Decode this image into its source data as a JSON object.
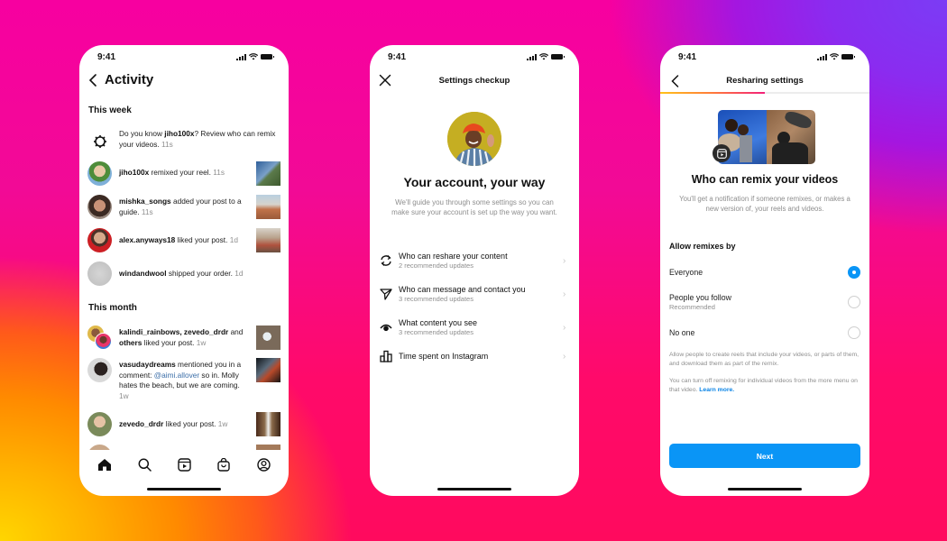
{
  "colors": {
    "accent_blue": "#0a95f6",
    "link_blue": "#0a84e6",
    "mention_blue": "#3b6ea8",
    "muted_text": "#8e8e8e",
    "primary_text": "#111111"
  },
  "status_bar": {
    "time": "9:41"
  },
  "activity_screen": {
    "title": "Activity",
    "back_icon": "chevron-left-icon",
    "sections": [
      {
        "heading": "This week",
        "items": [
          {
            "type": "prompt",
            "icon": "settings-gear-icon",
            "prefix": "Do you know ",
            "user": "jiho100x",
            "text": "? Review who can remix your videos.",
            "time": "11s"
          },
          {
            "type": "activity",
            "user": "jiho100x",
            "text": " remixed your reel.",
            "time": "11s",
            "has_thumbnail": true
          },
          {
            "type": "activity",
            "user": "mishka_songs",
            "text": " added your post to a guide.",
            "time": "11s",
            "has_thumbnail": true
          },
          {
            "type": "activity",
            "user": "alex.anyways18",
            "text": " liked your post.",
            "time": "1d",
            "has_thumbnail": true
          },
          {
            "type": "activity",
            "user": "windandwool",
            "text": " shipped your order.",
            "time": "1d",
            "has_thumbnail": false
          }
        ]
      },
      {
        "heading": "This month",
        "items": [
          {
            "type": "activity",
            "user": "kalindi_rainbows, zevedo_drdr",
            "middle": " and ",
            "user2": "others",
            "text": " liked your post.",
            "time": "1w",
            "has_thumbnail": true
          },
          {
            "type": "activity",
            "user": "vasudaydreams",
            "text": " mentioned you in a comment: ",
            "mention": "@aimi.allover",
            "text2": " so in. Molly hates the beach, but we are coming.",
            "time": "1w",
            "has_thumbnail": true
          },
          {
            "type": "activity",
            "user": "zevedo_drdr",
            "text": " liked your post.",
            "time": "1w",
            "has_thumbnail": true
          }
        ]
      }
    ],
    "tab_bar": [
      {
        "name": "home",
        "icon": "home-icon",
        "active": true
      },
      {
        "name": "search",
        "icon": "search-icon",
        "active": false
      },
      {
        "name": "reels",
        "icon": "reels-icon",
        "active": false
      },
      {
        "name": "shop",
        "icon": "shopping-bag-icon",
        "active": false
      },
      {
        "name": "profile",
        "icon": "profile-icon",
        "active": false
      }
    ]
  },
  "settings_checkup_screen": {
    "nav_title": "Settings checkup",
    "close_icon": "close-icon",
    "heading": "Your account, your way",
    "subtitle": "We'll guide you through some settings so you can make sure your account is set up the way you want.",
    "items": [
      {
        "icon": "reshare-icon",
        "title": "Who can reshare your content",
        "subtitle": "2 recommended updates"
      },
      {
        "icon": "send-icon",
        "title": "Who can message and contact you",
        "subtitle": "3 recommended updates"
      },
      {
        "icon": "eye-icon",
        "title": "What content you see",
        "subtitle": "3 recommended updates"
      },
      {
        "icon": "bar-chart-icon",
        "title": "Time spent on Instagram",
        "subtitle": ""
      }
    ]
  },
  "resharing_screen": {
    "nav_title": "Resharing settings",
    "progress_percent": 50,
    "heading": "Who can remix your videos",
    "subtitle": "You'll get a notification if someone remixes, or makes a new version of, your reels and videos.",
    "options_label": "Allow remixes by",
    "options": [
      {
        "label": "Everyone",
        "sublabel": "",
        "selected": true
      },
      {
        "label": "People you follow",
        "sublabel": "Recommended",
        "selected": false
      },
      {
        "label": "No one",
        "sublabel": "",
        "selected": false
      }
    ],
    "note1": "Allow people to create reels that include your videos, or parts of them, and download them as part of the remix.",
    "note2": "You can turn off remixing for individual videos from the more menu on that video. ",
    "learn_more": "Learn more.",
    "next_button": "Next"
  }
}
